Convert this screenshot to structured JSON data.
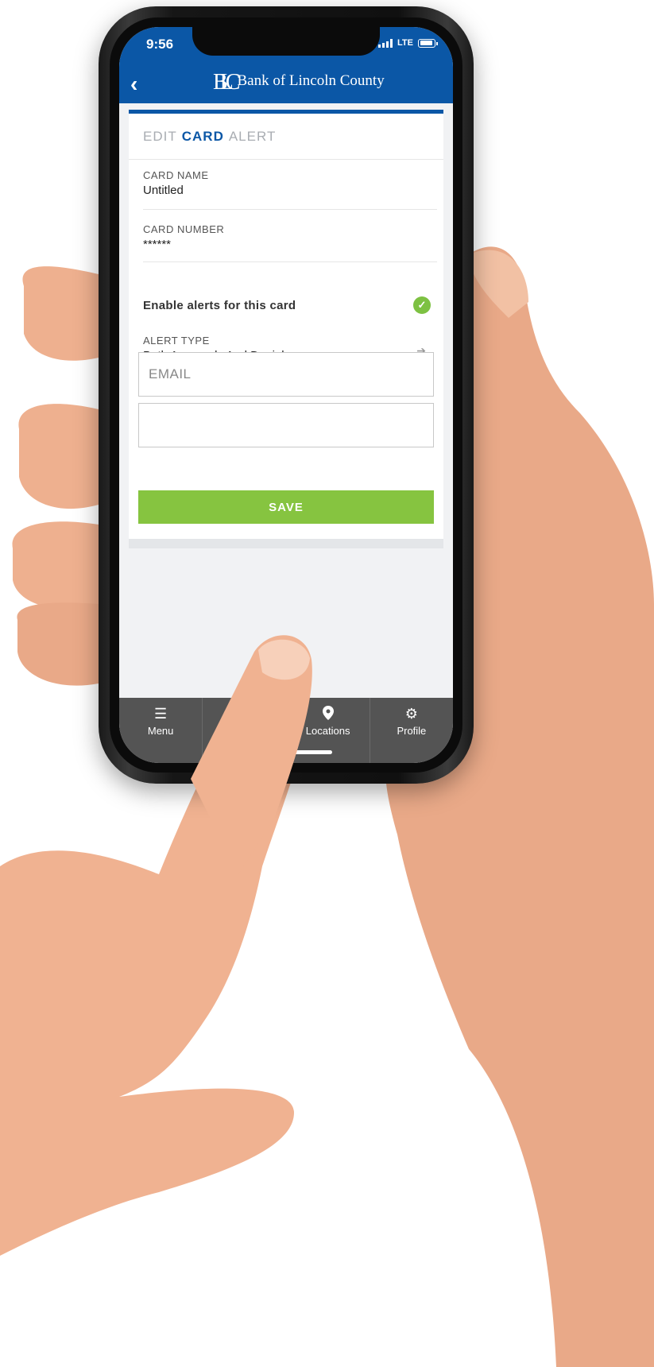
{
  "status_bar": {
    "time": "9:56",
    "network": "LTE"
  },
  "header": {
    "bank_name": "Bank of Lincoln County",
    "logo_monogram": "BLC"
  },
  "page_title": {
    "part1": "EDIT",
    "part2": "CARD",
    "part3": "ALERT"
  },
  "card_name": {
    "label": "CARD NAME",
    "value": "Untitled"
  },
  "card_number": {
    "label": "CARD NUMBER",
    "value": "******"
  },
  "enable_alerts": {
    "label": "Enable alerts for this card",
    "checked": true
  },
  "alert_type": {
    "label": "ALERT TYPE",
    "value": "Both Approvals And Denials"
  },
  "email_input": {
    "placeholder": "EMAIL",
    "value": ""
  },
  "second_input": {
    "value": ""
  },
  "save_button": {
    "label": "SAVE"
  },
  "tabbar": {
    "items": [
      {
        "label": "Menu",
        "icon": "menu-icon"
      },
      {
        "label": "",
        "icon": ""
      },
      {
        "label": "Locations",
        "icon": "location-pin-icon"
      },
      {
        "label": "Profile",
        "icon": "gear-icon"
      }
    ]
  },
  "colors": {
    "header_blue": "#0b57a6",
    "save_green": "#86c440",
    "check_green": "#7dc142",
    "tabbar": "#545454"
  }
}
